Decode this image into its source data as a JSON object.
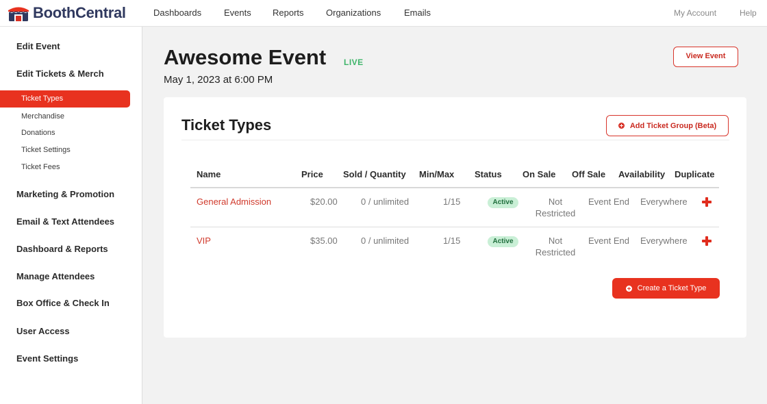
{
  "brand": {
    "name": "BoothCentral",
    "icon": "tent-booth-icon"
  },
  "topnav": {
    "items": [
      "Dashboards",
      "Events",
      "Reports",
      "Organizations",
      "Emails"
    ],
    "account": "My Account",
    "help": "Help"
  },
  "sidebar": {
    "sections": [
      {
        "label": "Edit Event"
      },
      {
        "label": "Edit Tickets & Merch"
      },
      {
        "label": "Marketing & Promotion"
      },
      {
        "label": "Email & Text Attendees"
      },
      {
        "label": "Dashboard & Reports"
      },
      {
        "label": "Manage Attendees"
      },
      {
        "label": "Box Office & Check In"
      },
      {
        "label": "User Access"
      },
      {
        "label": "Event Settings"
      }
    ],
    "sub_items": [
      "Ticket Types",
      "Merchandise",
      "Donations",
      "Ticket Settings",
      "Ticket Fees"
    ],
    "active_sub": "Ticket Types"
  },
  "event": {
    "title": "Awesome Event",
    "status": "LIVE",
    "date": "May 1, 2023 at 6:00 PM",
    "view_button": "View Event"
  },
  "ticket_types": {
    "title": "Ticket Types",
    "add_group_button": "Add Ticket Group (Beta)",
    "columns": [
      "Name",
      "Price",
      "Sold / Quantity",
      "Min/Max",
      "Status",
      "On Sale",
      "Off Sale",
      "Availability",
      "Duplicate"
    ],
    "rows": [
      {
        "name": "General Admission",
        "price": "$20.00",
        "sold_quantity": "0 / unlimited",
        "min_max": "1/15",
        "status": "Active",
        "on_sale_1": "Not",
        "on_sale_2": "Restricted",
        "off_sale": "Event End",
        "availability": "Everywhere",
        "duplicate_icon": "plus-icon"
      },
      {
        "name": "VIP",
        "price": "$35.00",
        "sold_quantity": "0 / unlimited",
        "min_max": "1/15",
        "status": "Active",
        "on_sale_1": "Not",
        "on_sale_2": "Restricted",
        "off_sale": "Event End",
        "availability": "Everywhere",
        "duplicate_icon": "plus-icon"
      }
    ],
    "create_button": "Create a Ticket Type"
  },
  "colors": {
    "accent": "#e8321f",
    "brand_text": "#30395f",
    "live": "#3fb56a",
    "active_pill_bg": "#c9efd6",
    "background": "#f2f2f2"
  }
}
